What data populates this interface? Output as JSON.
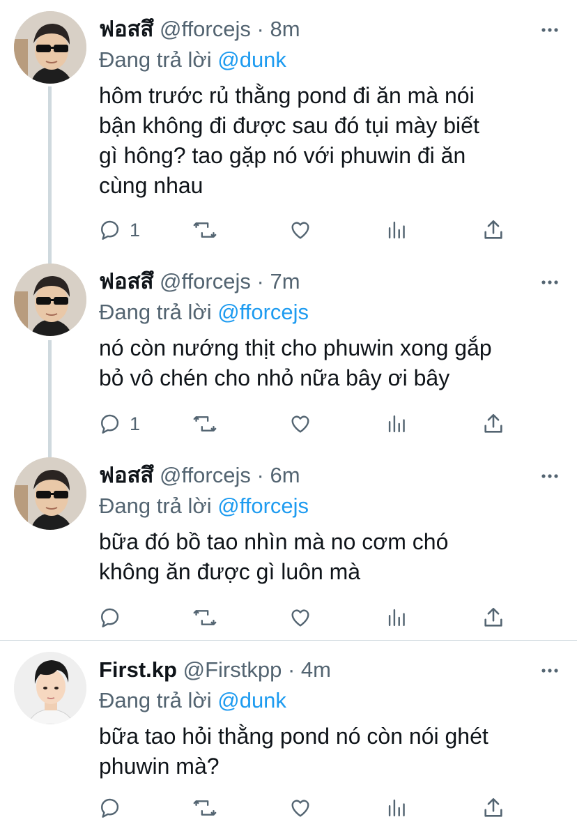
{
  "tweets": [
    {
      "name": "ฟอสสึ",
      "handle": "@fforcejs",
      "sep": "·",
      "time": "8m",
      "replying_prefix": "Đang trả lời ",
      "replying_to": "@dunk",
      "text": "hôm trước rủ thằng pond đi ăn mà nói\nbận không đi được sau đó tụi mày biết\ngì hông? tao gặp nó với phuwin đi ăn\ncùng nhau",
      "reply_count": "1"
    },
    {
      "name": "ฟอสสึ",
      "handle": "@fforcejs",
      "sep": "·",
      "time": "7m",
      "replying_prefix": "Đang trả lời ",
      "replying_to": "@fforcejs",
      "text": "nó còn nướng thịt cho phuwin xong gắp\nbỏ vô chén cho nhỏ nữa bây ơi bây",
      "reply_count": "1"
    },
    {
      "name": "ฟอสสึ",
      "handle": "@fforcejs",
      "sep": "·",
      "time": "6m",
      "replying_prefix": "Đang trả lời ",
      "replying_to": "@fforcejs",
      "text": "bữa đó bồ tao nhìn mà no cơm chó\nkhông ăn được gì luôn mà",
      "reply_count": ""
    },
    {
      "name": "First.kp",
      "handle": "@Firstkpp",
      "sep": "·",
      "time": "4m",
      "replying_prefix": "Đang trả lời ",
      "replying_to": "@dunk",
      "text": "bữa tao hỏi thằng pond nó còn nói ghét\nphuwin mà?",
      "reply_count": ""
    }
  ],
  "icons": {
    "reply": "speech-bubble-icon",
    "retweet": "retweet-icon",
    "like": "heart-icon",
    "analytics": "bar-chart-icon",
    "share": "share-upload-icon",
    "more": "more-dots-icon"
  },
  "colors": {
    "text": "#0f1419",
    "secondary": "#536471",
    "link": "#1d9bf0",
    "thread_line": "#cfd9de"
  }
}
